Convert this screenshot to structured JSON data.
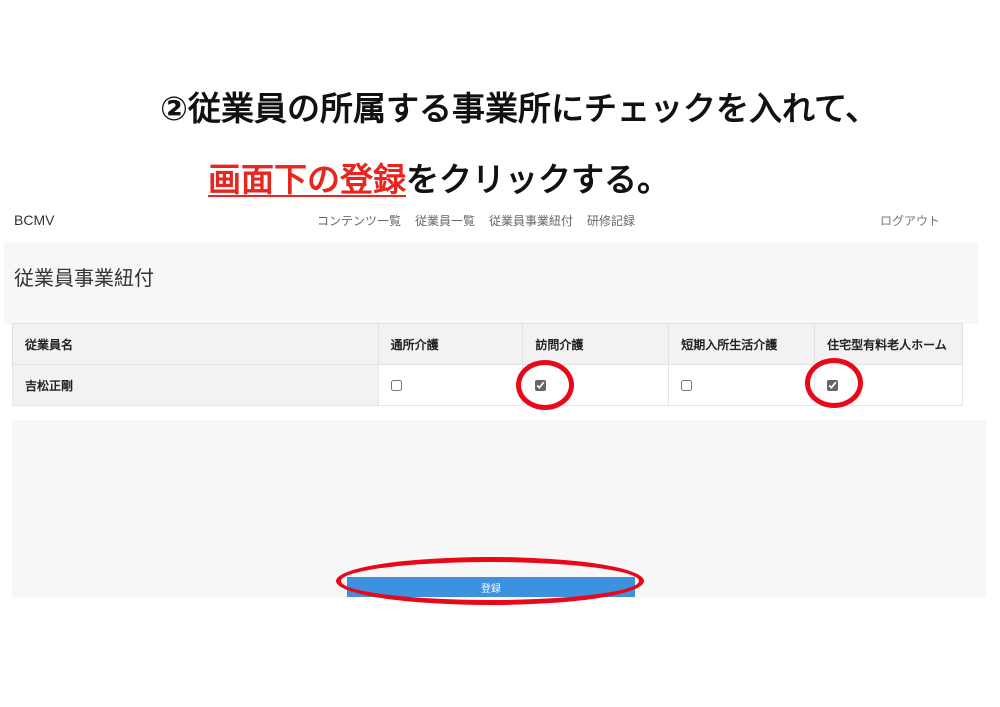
{
  "instruction": {
    "line1": "②従業員の所属する事業所にチェックを入れて、",
    "line2_highlight": "画面下の登録",
    "line2_rest": "をクリックする。"
  },
  "navbar": {
    "brand": "BCMV",
    "links": [
      "コンテンツ一覧",
      "従業員一覧",
      "従業員事業紐付",
      "研修記録"
    ],
    "logout": "ログアウト"
  },
  "page": {
    "title": "従業員事業紐付"
  },
  "table": {
    "headers": [
      "従業員名",
      "通所介護",
      "訪問介護",
      "短期入所生活介護",
      "住宅型有料老人ホーム"
    ],
    "rows": [
      {
        "name": "吉松正剛",
        "checks": [
          false,
          true,
          false,
          true
        ]
      }
    ]
  },
  "register_button": {
    "label": "登録"
  },
  "colors": {
    "highlight_red": "#e8261f",
    "annotation_circle": "#e8081a",
    "button_blue": "#3e91de"
  }
}
